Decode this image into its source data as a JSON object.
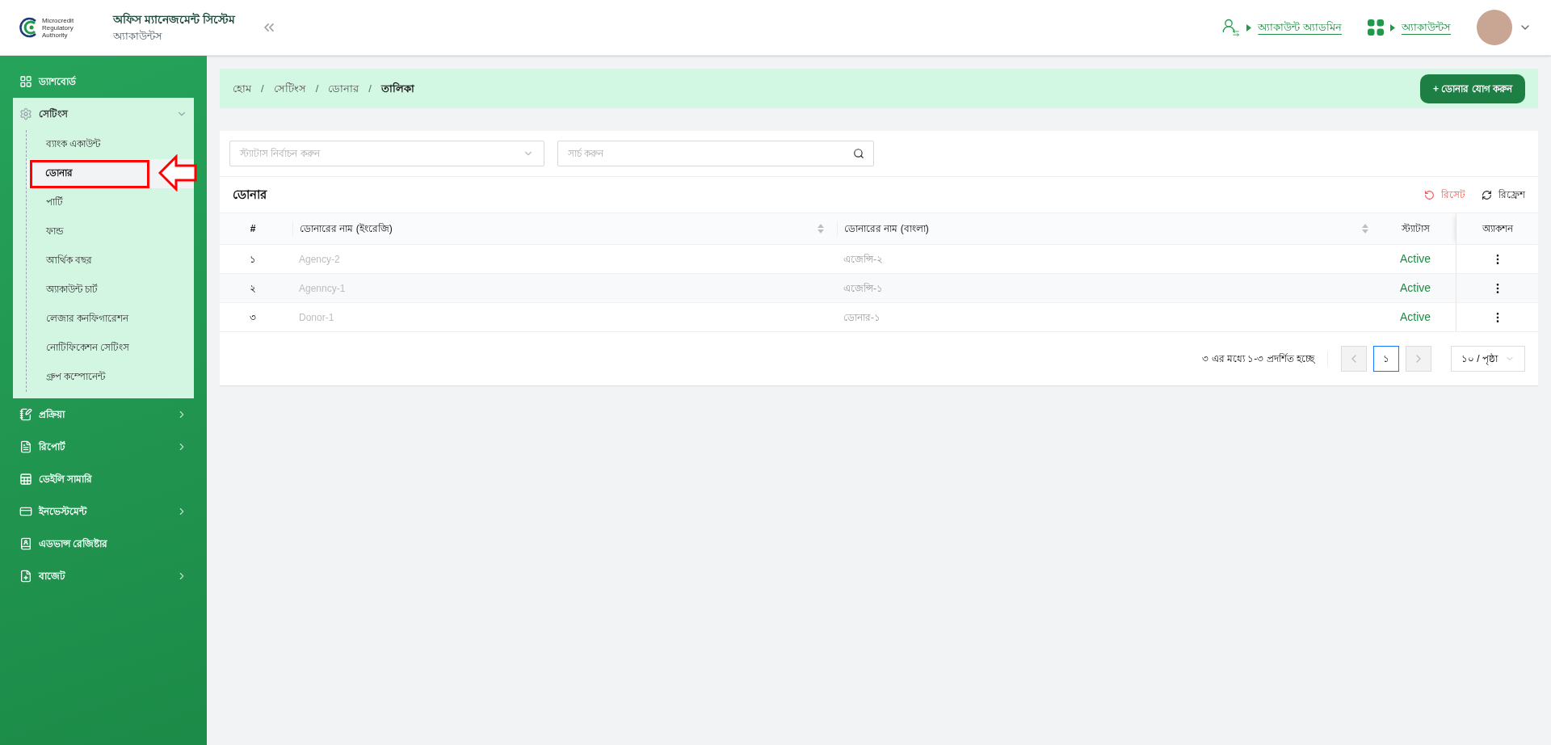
{
  "header": {
    "logo_text": "Microcredit Regulatory Authority",
    "title": "অফিস ম্যানেজমেন্ট সিস্টেম",
    "subtitle": "অ্যাকাউন্টস",
    "links": [
      {
        "kind": "user",
        "label": "অ্যাকাউন্ট অ্যাডমিন"
      },
      {
        "kind": "apps",
        "label": "অ্যাকাউন্টস"
      }
    ]
  },
  "sidebar": {
    "items": [
      {
        "kind": "link",
        "label": "ড্যাশবোর্ড"
      },
      {
        "kind": "group",
        "label": "সেটিংস",
        "expanded": true,
        "children": [
          {
            "label": "ব্যাংক একাউন্ট",
            "selected": false
          },
          {
            "label": "ডোনার",
            "selected": true
          },
          {
            "label": "পার্টি",
            "selected": false
          },
          {
            "label": "ফান্ড",
            "selected": false
          },
          {
            "label": "আর্থিক বছর",
            "selected": false
          },
          {
            "label": "অ্যাকাউন্ট চার্ট",
            "selected": false
          },
          {
            "label": "লেজার কনফিগারেশন",
            "selected": false
          },
          {
            "label": "নোটিফিকেশন সেটিংস",
            "selected": false
          },
          {
            "label": "গ্রুপ কম্পোনেন্ট",
            "selected": false
          }
        ]
      },
      {
        "kind": "group",
        "label": "প্রক্রিয়া",
        "expanded": false
      },
      {
        "kind": "group",
        "label": "রিপোর্ট",
        "expanded": false
      },
      {
        "kind": "link",
        "label": "ডেইলি সামারি"
      },
      {
        "kind": "group",
        "label": "ইনভেস্টমেন্ট",
        "expanded": false
      },
      {
        "kind": "link",
        "label": "এডভান্স রেজিষ্টার"
      },
      {
        "kind": "group",
        "label": "বাজেট",
        "expanded": false
      }
    ]
  },
  "breadcrumb": [
    {
      "label": "হোম",
      "current": false
    },
    {
      "separator": "/",
      "label": "সেটিংস",
      "current": false
    },
    {
      "separator": "/",
      "label": "ডোনার",
      "current": false
    },
    {
      "separator": "/",
      "label": "তালিকা",
      "current": true
    }
  ],
  "add_button": "+ ডোনার যোগ করুন",
  "filters": {
    "status": {
      "placeholder": "স্ট্যাটাস নির্বাচন করুন"
    },
    "search": {
      "placeholder": "সার্চ করুন"
    }
  },
  "table": {
    "title": "ডোনার",
    "reset": "রিসেট",
    "refresh": "রিফ্রেশ",
    "columns": [
      {
        "label": "#",
        "sortable": false
      },
      {
        "label": "ডোনারের নাম (ইংরেজি)",
        "sortable": true
      },
      {
        "label": "ডোনারের নাম (বাংলা)",
        "sortable": true
      },
      {
        "label": "স্ট্যাটাস",
        "sortable": false
      },
      {
        "label": "অ্যাকশন",
        "sortable": false
      }
    ],
    "rows": [
      {
        "no": "১",
        "name_en": "Agency-2",
        "name_bn": "এজেন্সি-২",
        "status": "Active"
      },
      {
        "no": "২",
        "name_en": "Agenncy-1",
        "name_bn": "এজেন্সি-১",
        "status": "Active"
      },
      {
        "no": "৩",
        "name_en": "Donor-1",
        "name_bn": "ডোনার-১",
        "status": "Active"
      }
    ]
  },
  "pagination": {
    "summary": "৩ এর মধ্যে ১-৩ প্রদর্শিত হচ্ছে",
    "pages": [
      {
        "label": "১",
        "selected": true
      }
    ],
    "page_size": "১০ / পৃষ্ঠা"
  }
}
